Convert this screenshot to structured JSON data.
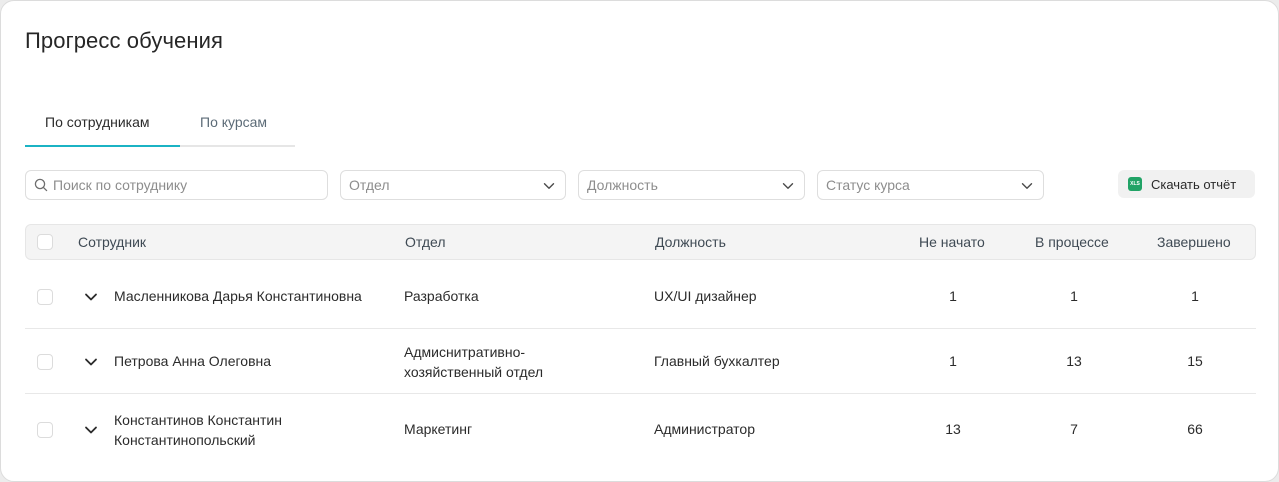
{
  "page": {
    "title": "Прогресс обучения"
  },
  "tabs": [
    {
      "label": "По сотрудникам",
      "active": true
    },
    {
      "label": "По курсам",
      "active": false
    }
  ],
  "filters": {
    "search_placeholder": "Поиск по сотруднику",
    "department_placeholder": "Отдел",
    "position_placeholder": "Должность",
    "course_status_placeholder": "Статус курса",
    "export_label": "Скачать отчёт",
    "export_icon_text": "XLS"
  },
  "table": {
    "columns": {
      "employee": "Сотрудник",
      "department": "Отдел",
      "position": "Должность",
      "not_started": "Не начато",
      "in_progress": "В процессе",
      "completed": "Завершено"
    },
    "rows": [
      {
        "name_1": "Масленникова Дарья Константиновна",
        "name_2": "",
        "dept_1": "Разработка",
        "dept_2": "",
        "position": "UX/UI дизайнер",
        "not_started": "1",
        "in_progress": "1",
        "completed": "1"
      },
      {
        "name_1": "Петрова Анна Олеговна",
        "name_2": "",
        "dept_1": "Адмиснитративно-",
        "dept_2": "хозяйственный отдел",
        "position": "Главный бухкалтер",
        "not_started": "1",
        "in_progress": "13",
        "completed": "15"
      },
      {
        "name_1": "Константинов Константин",
        "name_2": "Константинопольский",
        "dept_1": "Маркетинг",
        "dept_2": "",
        "position": "Администратор",
        "not_started": "13",
        "in_progress": "7",
        "completed": "66"
      }
    ]
  },
  "colors": {
    "accent": "#1bb3c4",
    "xls": "#21a366"
  }
}
